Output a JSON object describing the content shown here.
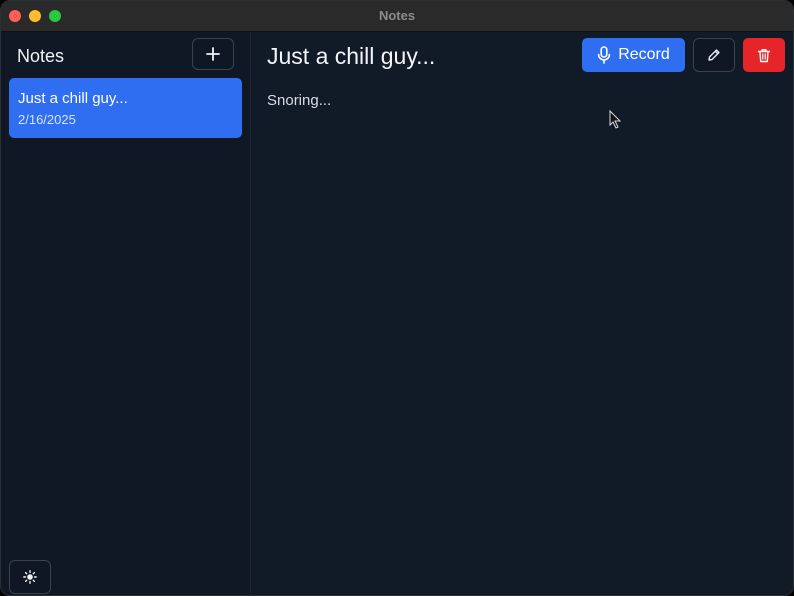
{
  "window": {
    "title": "Notes"
  },
  "sidebar": {
    "title": "Notes",
    "add_icon": "plus-icon",
    "notes": [
      {
        "title": "Just a chill guy...",
        "date": "2/16/2025",
        "selected": true
      }
    ],
    "theme_icon": "sun-icon"
  },
  "main": {
    "note_title": "Just a chill guy...",
    "record_label": "Record",
    "record_icon": "microphone-icon",
    "edit_icon": "pencil-icon",
    "delete_icon": "trash-icon",
    "note_body": "Snoring..."
  },
  "colors": {
    "accent": "#2f6ef0",
    "danger": "#e5252a",
    "background": "#111a27",
    "sidebar_background": "#101826"
  }
}
